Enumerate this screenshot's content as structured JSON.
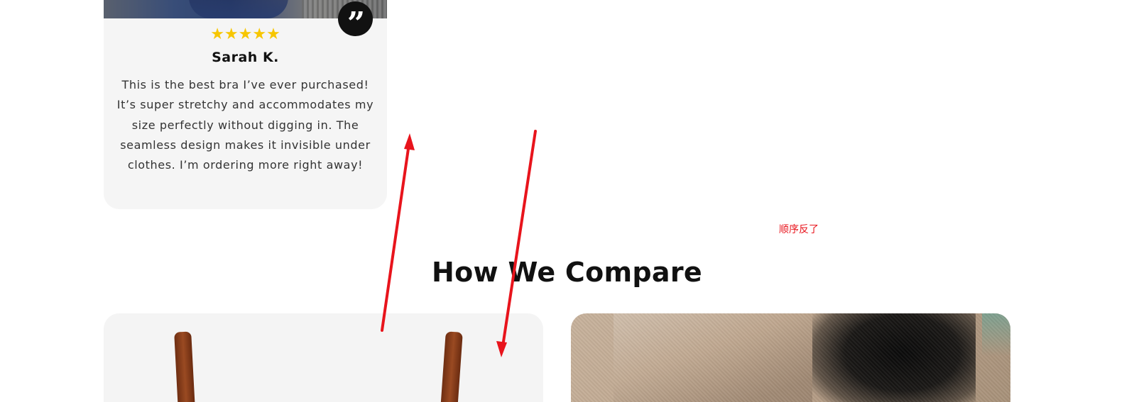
{
  "review": {
    "rating_display": "★★★★★",
    "rating": 5,
    "rating_max": 5,
    "reviewer_name": "Sarah K.",
    "text": "This is the best bra I’ve ever purchased! It’s super stretchy and accommodates my size perfectly without digging in. The seamless design makes it invisible under clothes. I’m ordering more right away!",
    "quote_glyph": "”",
    "quote_icon": "quote-icon"
  },
  "annotation": {
    "note": "顺序反了",
    "color": "#e8141c"
  },
  "section": {
    "title": "How We Compare"
  },
  "colors": {
    "star": "#f7c600",
    "heading": "#111111",
    "card_background": "#f5f5f5",
    "quote_badge": "#111111"
  }
}
